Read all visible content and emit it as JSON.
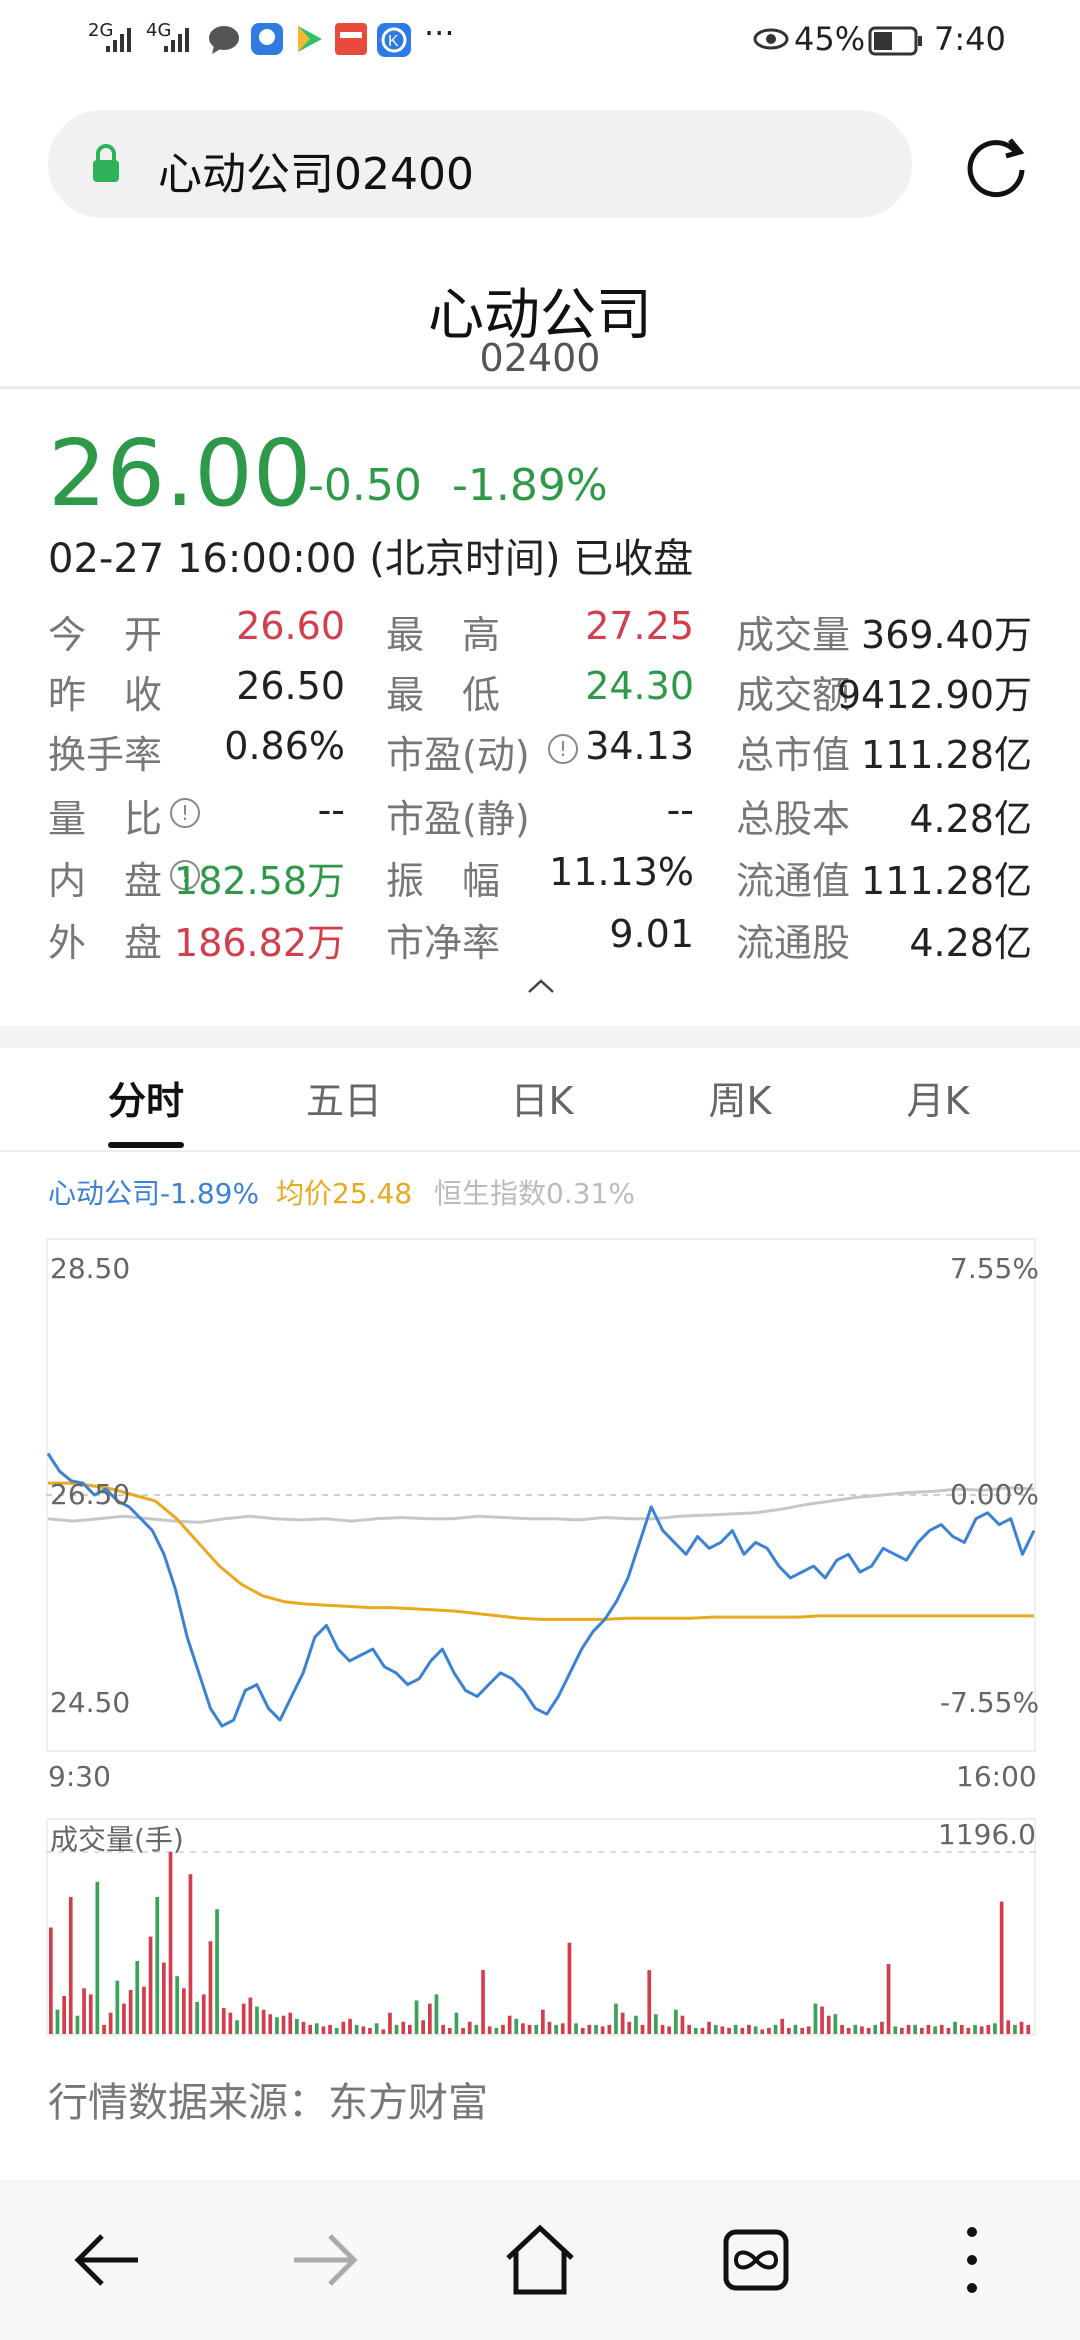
{
  "status": {
    "network1": "2G",
    "network2": "4G",
    "battery": "45%",
    "time": "7:40",
    "more": "···"
  },
  "url": {
    "text": "心动公司02400"
  },
  "stock": {
    "name": "心动公司",
    "code": "02400",
    "price": "26.00",
    "change": "-0.50",
    "change_pct": "-1.89%",
    "time": "02-27 16:00:00 (北京时间) 已收盘"
  },
  "stats": {
    "col1": [
      {
        "label": "今　开",
        "value": "26.60",
        "color": "red"
      },
      {
        "label": "昨　收",
        "value": "26.50",
        "color": "black"
      },
      {
        "label": "换手率",
        "value": "0.86%",
        "color": "black"
      },
      {
        "label": "量　比",
        "value": "--",
        "color": "black",
        "info": true
      },
      {
        "label": "内　盘",
        "value": "182.58万",
        "color": "green",
        "info": true
      },
      {
        "label": "外　盘",
        "value": "186.82万",
        "color": "red"
      }
    ],
    "col2": [
      {
        "label": "最　高",
        "value": "27.25",
        "color": "red"
      },
      {
        "label": "最　低",
        "value": "24.30",
        "color": "green"
      },
      {
        "label": "市盈(动)",
        "value": "34.13",
        "color": "black",
        "info": true
      },
      {
        "label": "市盈(静)",
        "value": "--",
        "color": "black"
      },
      {
        "label": "振　幅",
        "value": "11.13%",
        "color": "black"
      },
      {
        "label": "市净率",
        "value": "9.01",
        "color": "black"
      }
    ],
    "col3": [
      {
        "label": "成交量",
        "value": "369.40万"
      },
      {
        "label": "成交额",
        "value": "9412.90万"
      },
      {
        "label": "总市值",
        "value": "111.28亿"
      },
      {
        "label": "总股本",
        "value": "4.28亿"
      },
      {
        "label": "流通值",
        "value": "111.28亿"
      },
      {
        "label": "流通股",
        "value": "4.28亿"
      }
    ],
    "info_glyph": "!"
  },
  "tabs": [
    {
      "label": "分时",
      "active": true
    },
    {
      "label": "五日"
    },
    {
      "label": "日K"
    },
    {
      "label": "周K"
    },
    {
      "label": "月K"
    }
  ],
  "legend": {
    "stock": "心动公司-1.89%",
    "avg": "均价25.48",
    "index": "恒生指数0.31%"
  },
  "chart_data": [
    {
      "type": "line",
      "y_left_top": "28.50",
      "y_left_mid": "26.50",
      "y_left_bottom": "24.50",
      "y_right_top": "7.55%",
      "y_right_mid": "0.00%",
      "y_right_bottom": "-7.55%",
      "x_start": "9:30",
      "x_end": "16:00",
      "ylim": [
        24.5,
        28.5
      ],
      "prev_close": 26.5,
      "series": [
        {
          "color": "#3b82d6",
          "values": [
            26.85,
            26.7,
            26.62,
            26.6,
            26.5,
            26.55,
            26.45,
            26.4,
            26.3,
            26.2,
            26.0,
            25.7,
            25.3,
            25.0,
            24.7,
            24.55,
            24.6,
            24.85,
            24.9,
            24.7,
            24.6,
            24.8,
            25.0,
            25.3,
            25.4,
            25.2,
            25.1,
            25.15,
            25.2,
            25.05,
            25.0,
            24.9,
            24.95,
            25.1,
            25.2,
            25.0,
            24.85,
            24.8,
            24.9,
            25.0,
            24.95,
            24.85,
            24.7,
            24.65,
            24.8,
            25.0,
            25.2,
            25.35,
            25.45,
            25.6,
            25.8,
            26.1,
            26.4,
            26.2,
            26.1,
            26.0,
            26.15,
            26.05,
            26.1,
            26.2,
            26.0,
            26.1,
            26.05,
            25.9,
            25.8,
            25.85,
            25.9,
            25.8,
            25.95,
            26.0,
            25.85,
            25.9,
            26.05,
            26.0,
            25.95,
            26.1,
            26.2,
            26.25,
            26.15,
            26.1,
            26.3,
            26.35,
            26.25,
            26.3,
            26.0,
            26.2
          ]
        },
        {
          "color": "#e8a91f",
          "values": [
            26.6,
            26.6,
            26.58,
            26.55,
            26.5,
            26.45,
            26.3,
            26.1,
            25.9,
            25.75,
            25.65,
            25.6,
            25.58,
            25.57,
            25.56,
            25.55,
            25.55,
            25.54,
            25.53,
            25.52,
            25.5,
            25.48,
            25.46,
            25.45,
            25.45,
            25.45,
            25.45,
            25.46,
            25.46,
            25.46,
            25.46,
            25.47,
            25.47,
            25.47,
            25.47,
            25.47,
            25.48,
            25.48,
            25.48,
            25.48,
            25.48,
            25.48,
            25.48,
            25.48,
            25.48,
            25.48,
            25.48
          ]
        },
        {
          "color": "#c7c7c7",
          "values": [
            26.3,
            26.28,
            26.3,
            26.32,
            26.3,
            26.28,
            26.27,
            26.3,
            26.32,
            26.3,
            26.29,
            26.3,
            26.28,
            26.3,
            26.31,
            26.3,
            26.3,
            26.32,
            26.31,
            26.3,
            26.3,
            26.29,
            26.31,
            26.3,
            26.3,
            26.32,
            26.33,
            26.34,
            26.35,
            26.38,
            26.42,
            26.45,
            26.48,
            26.5,
            26.52,
            26.53,
            26.55,
            26.54,
            26.56,
            26.55
          ]
        }
      ]
    },
    {
      "type": "bar",
      "title": "成交量(手)",
      "y_max_label": "1196.0",
      "values": [
        700,
        160,
        250,
        900,
        120,
        300,
        260,
        1000,
        60,
        140,
        350,
        200,
        290,
        480,
        310,
        640,
        900,
        470,
        1196,
        380,
        300,
        1050,
        210,
        260,
        610,
        820,
        170,
        140,
        90,
        200,
        240,
        180,
        160,
        130,
        110,
        120,
        140,
        100,
        80,
        60,
        70,
        50,
        60,
        40,
        80,
        100,
        60,
        50,
        40,
        70,
        30,
        140,
        60,
        80,
        60,
        220,
        90,
        200,
        260,
        60,
        40,
        140,
        40,
        80,
        60,
        420,
        50,
        40,
        60,
        120,
        100,
        70,
        60,
        60,
        160,
        80,
        60,
        70,
        600,
        70,
        40,
        60,
        60,
        50,
        60,
        200,
        140,
        80,
        120,
        60,
        420,
        130,
        60,
        50,
        160,
        120,
        60,
        40,
        40,
        80,
        60,
        50,
        40,
        60,
        40,
        60,
        50,
        30,
        40,
        60,
        100,
        40,
        60,
        40,
        50,
        200,
        180,
        120,
        130,
        60,
        40,
        60,
        50,
        40,
        60,
        80,
        460,
        50,
        40,
        60,
        60,
        40,
        60,
        50,
        60,
        40,
        80,
        60,
        40,
        60,
        50,
        60,
        70,
        870,
        90,
        60,
        80,
        60
      ],
      "colors_note": "mixed red and green bars"
    }
  ],
  "source": "行情数据来源：东方财富"
}
